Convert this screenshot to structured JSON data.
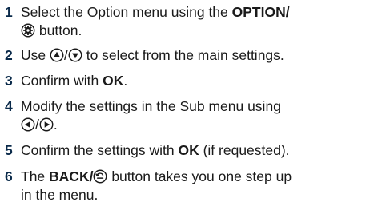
{
  "steps": [
    {
      "num": "1",
      "t1": "Select the Option menu using the ",
      "b1": "OPTION/",
      "t2": " button."
    },
    {
      "num": "2",
      "t1": "Use ",
      "sep": "/",
      "t2": " to select from the main settings."
    },
    {
      "num": "3",
      "t1": "Confirm with ",
      "b1": "OK",
      "t2": "."
    },
    {
      "num": "4",
      "t1": "Modify the settings in the Sub menu using",
      "sep": "/",
      "t2": "."
    },
    {
      "num": "5",
      "t1": "Confirm the settings with ",
      "b1": "OK",
      "t2": " (if requested)."
    },
    {
      "num": "6",
      "t1": "The ",
      "b1": "BACK/",
      "t2": " button takes you one step up",
      "t3": "in the menu."
    }
  ],
  "icons": {
    "option": "gear-in-circle",
    "up": "up-triangle-in-circle",
    "down": "down-triangle-in-circle",
    "left": "left-triangle-in-circle",
    "right": "right-triangle-in-circle",
    "back": "back-arrow-in-circle"
  }
}
